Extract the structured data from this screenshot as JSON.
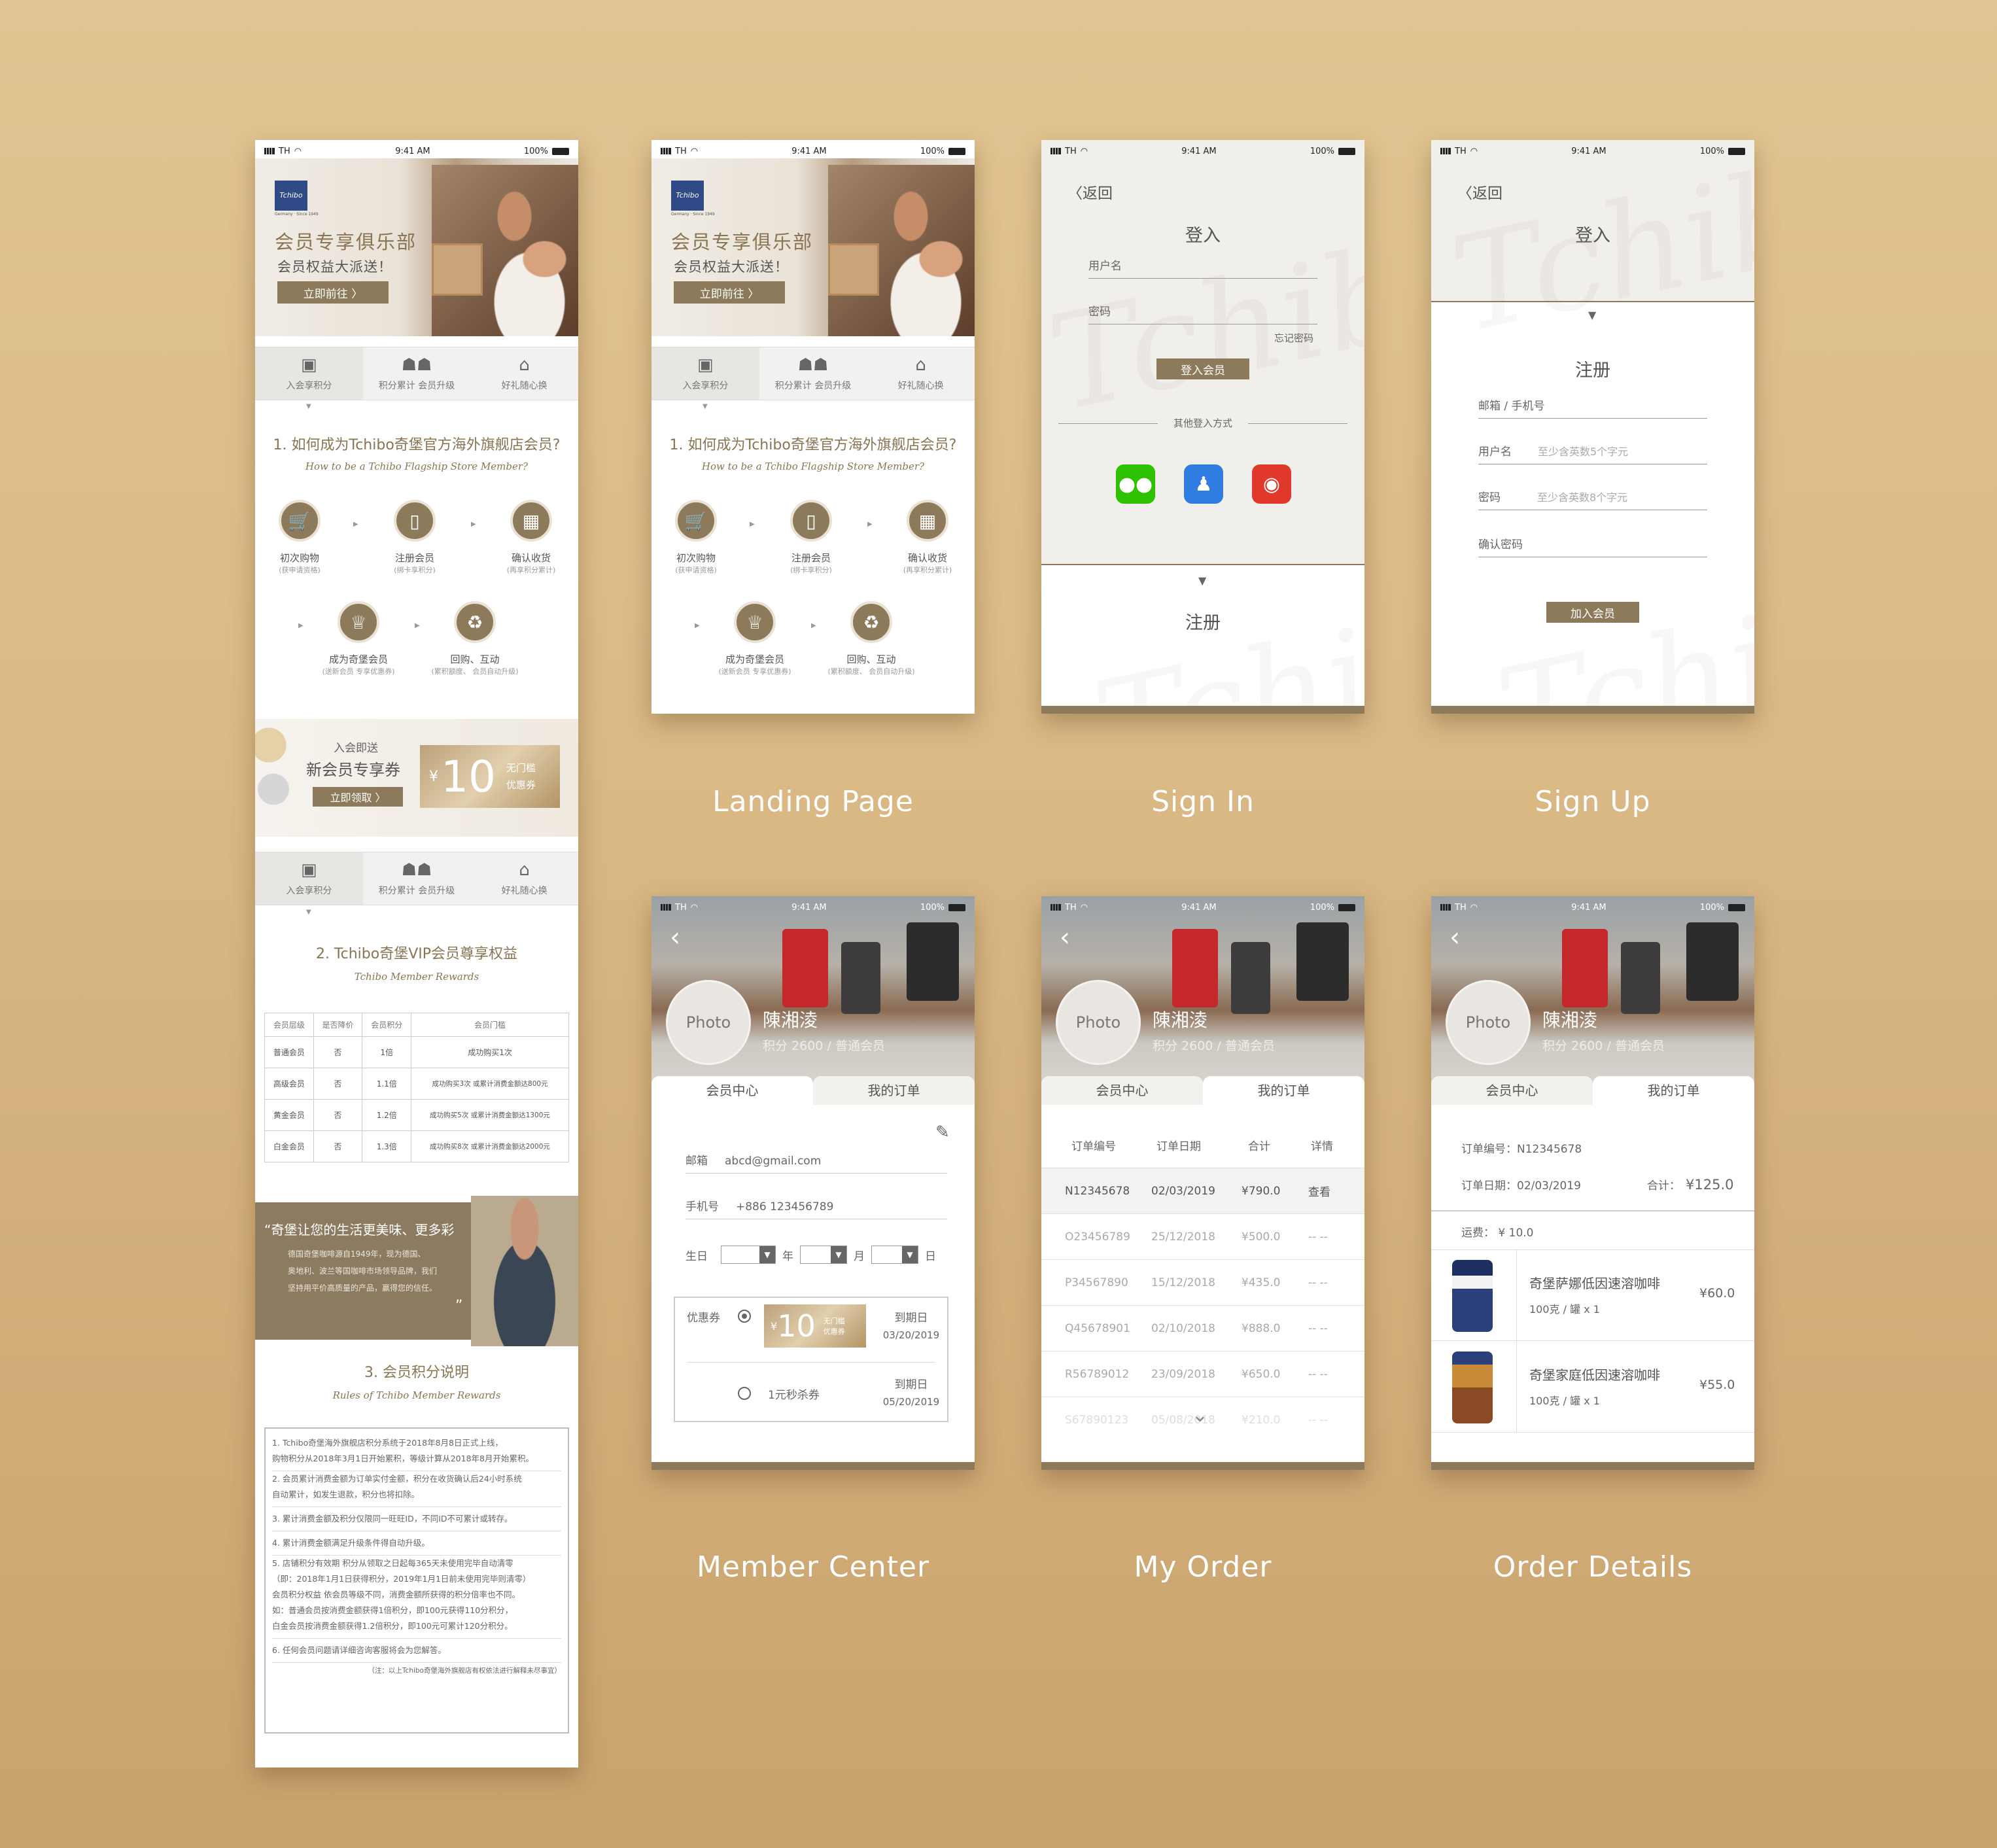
{
  "colors": {
    "accent": "#8c7a5b",
    "bg": "#dcbc88"
  },
  "status": {
    "carrier": "TH",
    "time": "9:41 AM",
    "battery": "100%"
  },
  "captions": {
    "landing": "Landing Page",
    "signin": "Sign In",
    "signup": "Sign Up",
    "member": "Member Center",
    "order": "My Order",
    "details": "Order Details"
  },
  "landing": {
    "logo": "Tchibo",
    "logo_sub": "Germany · Since 1949",
    "hero_title": "会员专享俱乐部",
    "hero_sub": "会员权益大派送！",
    "hero_btn": "立即前往 〉",
    "tabs": [
      "入会享积分",
      "积分累计 会员升级",
      "好礼随心换"
    ],
    "sec1_title": "1. 如何成为Tchibo奇堡官方海外旗舰店会员?",
    "sec1_sub": "How to be a Tchibo Flagship Store Member?",
    "steps": [
      {
        "label": "初次购物",
        "note": "(获申请资格)"
      },
      {
        "label": "注册会员",
        "note": "(绑卡享积分)"
      },
      {
        "label": "确认收货",
        "note": "(再享积分累计)"
      },
      {
        "label": "成为奇堡会员",
        "note": "(送新会员 专享优惠券)"
      },
      {
        "label": "回购、互动",
        "note": "(累积额度、 会员自动升级)"
      }
    ],
    "coupon_kicker": "入会即送",
    "coupon_title": "新会员专享券",
    "coupon_btn": "立即领取 〉",
    "coupon_currency": "¥",
    "coupon_value": "10",
    "coupon_tag1": "无门槛",
    "coupon_tag2": "优惠券",
    "sec2_title": "2. Tchibo奇堡VIP会员尊享权益",
    "sec2_sub": "Tchibo Member Rewards",
    "table_head": [
      "会员层级",
      "是否降价",
      "会员积分",
      "会员门槛"
    ],
    "table_rows": [
      [
        "普通会员",
        "否",
        "1倍",
        "成功购买1次"
      ],
      [
        "高级会员",
        "否",
        "1.1倍",
        "成功购买3次 或累计消费金额达800元"
      ],
      [
        "黄金会员",
        "否",
        "1.2倍",
        "成功购买5次 或累计消费金额达1300元"
      ],
      [
        "白金会员",
        "否",
        "1.3倍",
        "成功购买8次 或累计消费金额达2000元"
      ]
    ],
    "quote_title": "奇堡让您的生活更美味、更多彩",
    "quote_body": [
      "德国奇堡咖啡源自1949年，现为德国、",
      "奥地利、波兰等国咖啡市场领导品牌，我们",
      "坚持用平价高质量的产品，赢得您的信任。"
    ],
    "sec3_title": "3. 会员积分说明",
    "sec3_sub": "Rules of Tchibo Member Rewards",
    "rules": [
      "1. Tchibo奇堡海外旗舰店积分系统于2018年8月8日正式上线，",
      "购物积分从2018年3月1日开始累积，等级计算从2018年8月开始累积。",
      "2. 会员累计消费金额为订单实付金额，积分在收货确认后24小时系统",
      "自动累计，如发生退款，积分也将扣除。",
      "3. 累计消费金额及积分仅限同一旺旺ID，不同ID不可累计或转存。",
      "4. 累计消费金额满足升级条件得自动升级。",
      "5. 店铺积分有效期 积分从领取之日起每365天未使用完毕自动清零",
      "（即：2018年1月1日获得积分，2019年1月1日前未使用完毕则清零）",
      "会员积分权益 依会员等级不同，消费金额所获得的积分倍率也不同。",
      "如：普通会员按消费金额获得1倍积分，即100元获得110分积分，",
      "白金会员按消费金额获得1.2倍积分，即100元可累计120分积分。",
      "6. 任何会员问题请详细咨询客服将会为您解答。",
      "（注：以上Tchibo奇堡海外旗舰店有权依法进行解释未尽事宜）"
    ]
  },
  "signin": {
    "back": "返回",
    "title": "登入",
    "username": "用户名",
    "password": "密码",
    "forgot": "忘记密码",
    "login_btn": "登入会员",
    "other": "其他登入方式",
    "register": "注册",
    "watermark": "Tchibo"
  },
  "signup": {
    "back": "返回",
    "title": "登入",
    "register": "注册",
    "email": "邮箱 / 手机号",
    "username": "用户名",
    "username_ph": "至少含英数5个字元",
    "password": "密码",
    "password_ph": "至少含英数8个字元",
    "confirm": "确认密码",
    "join_btn": "加入会员"
  },
  "member": {
    "photo": "Photo",
    "name": "陳湘淩",
    "points": "积分 2600 / 普通会员",
    "tab1": "会员中心",
    "tab2": "我的订单"
  },
  "membercenter": {
    "email_label": "邮箱",
    "email": "abcd@gmail.com",
    "phone_label": "手机号",
    "phone": "+886 123456789",
    "birthday": "生日",
    "year": "年",
    "month": "月",
    "day": "日",
    "coupon_label": "优惠券",
    "coupon_value": "10",
    "coupon_tag1": "无门槛",
    "coupon_tag2": "优惠券",
    "expire_label": "到期日",
    "expire1": "03/20/2019",
    "coupon2": "1元秒杀券",
    "expire2": "05/20/2019"
  },
  "orders": {
    "head": [
      "订单编号",
      "订单日期",
      "合计",
      "详情"
    ],
    "rows": [
      [
        "N12345678",
        "02/03/2019",
        "¥790.0",
        "查看"
      ],
      [
        "O23456789",
        "25/12/2018",
        "¥500.0",
        "-- --"
      ],
      [
        "P34567890",
        "15/12/2018",
        "¥435.0",
        "-- --"
      ],
      [
        "Q45678901",
        "02/10/2018",
        "¥888.0",
        "-- --"
      ],
      [
        "R56789012",
        "23/09/2018",
        "¥650.0",
        "-- --"
      ],
      [
        "S67890123",
        "05/08/2018",
        "¥210.0",
        "-- --"
      ]
    ]
  },
  "details": {
    "order_no": "订单编号：N12345678",
    "order_date": "订单日期：02/03/2019",
    "total_label": "合计：",
    "total": "¥125.0",
    "shipping": "运费： ¥ 10.0",
    "items": [
      {
        "name": "奇堡萨娜低因速溶咖啡",
        "spec": "100克 / 罐  x 1",
        "price": "¥60.0"
      },
      {
        "name": "奇堡家庭低因速溶咖啡",
        "spec": "100克 / 罐  x 1",
        "price": "¥55.0"
      }
    ]
  }
}
